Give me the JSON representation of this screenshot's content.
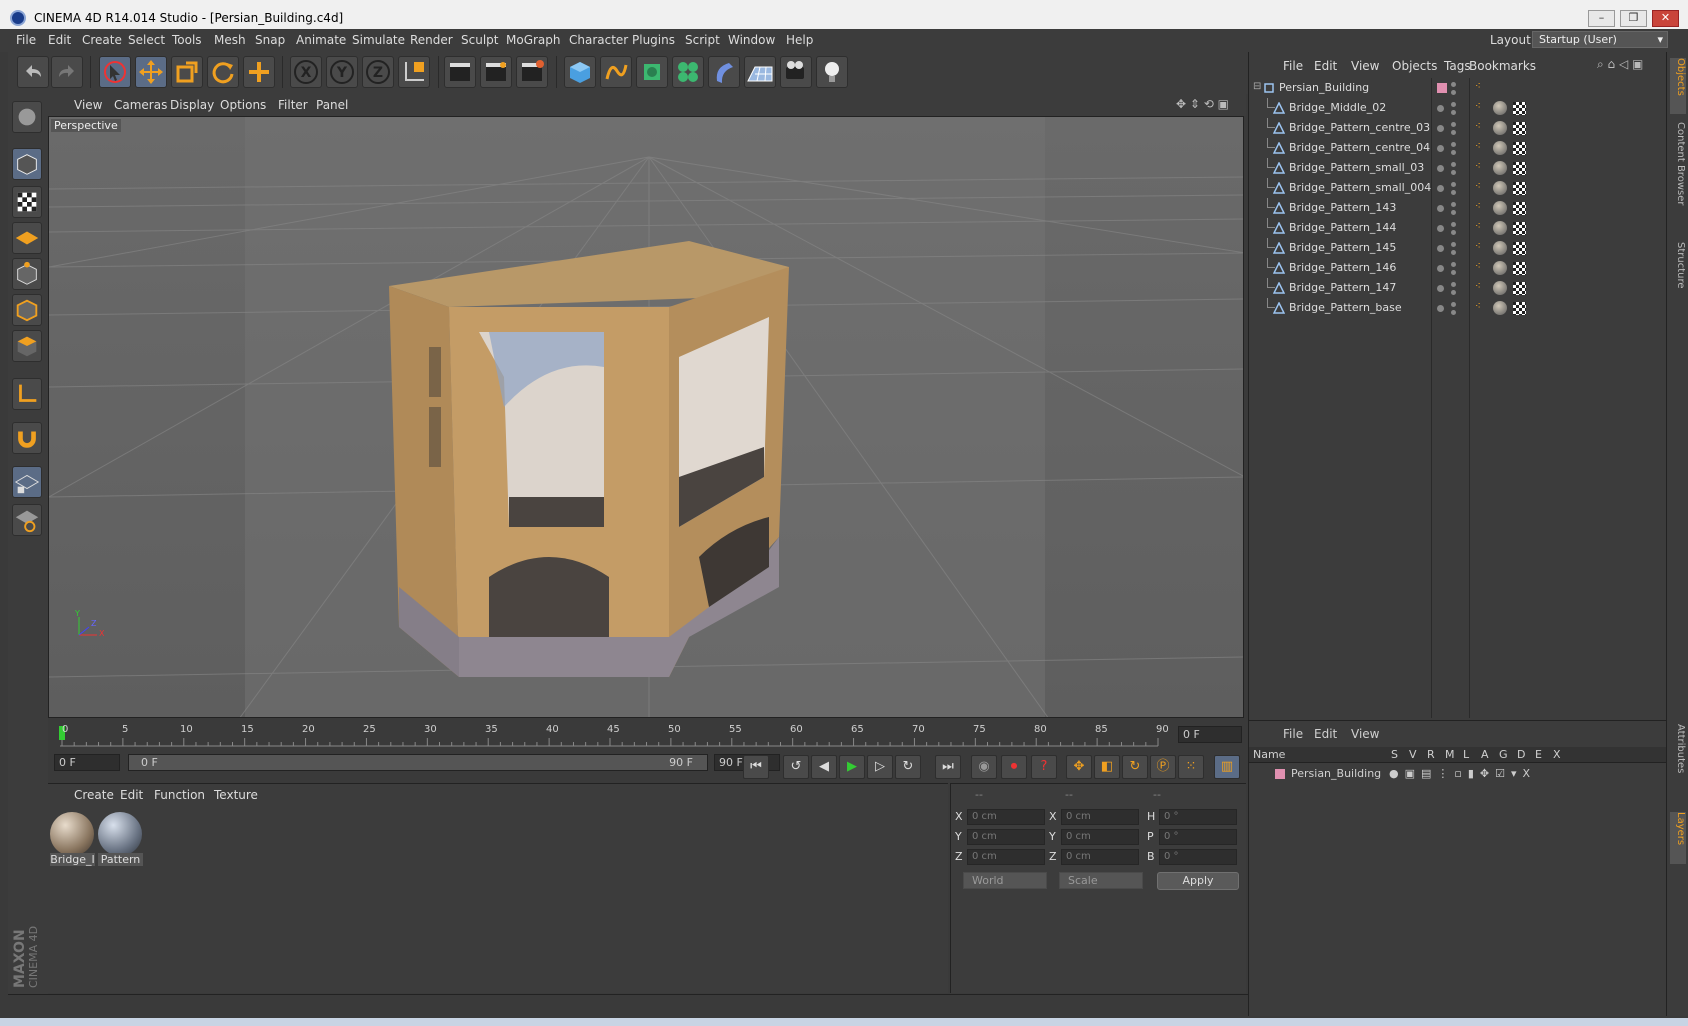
{
  "window": {
    "title": "CINEMA 4D R14.014 Studio - [Persian_Building.c4d]"
  },
  "menubar": {
    "items": [
      "File",
      "Edit",
      "Create",
      "Select",
      "Tools",
      "Mesh",
      "Snap",
      "Animate",
      "Simulate",
      "Render",
      "Sculpt",
      "MoGraph",
      "Character",
      "Plugins",
      "Script",
      "Window",
      "Help"
    ]
  },
  "layout": {
    "label": "Layout:",
    "value": "Startup (User)"
  },
  "viewport": {
    "menu": [
      "View",
      "Cameras",
      "Display",
      "Options",
      "Filter",
      "Panel"
    ],
    "label": "Perspective",
    "axis": {
      "y": "Y",
      "x": "X",
      "z": "Z"
    }
  },
  "timeline": {
    "ticks": [
      "0",
      "5",
      "10",
      "15",
      "20",
      "25",
      "30",
      "35",
      "40",
      "45",
      "50",
      "55",
      "60",
      "65",
      "70",
      "75",
      "80",
      "85",
      "90"
    ],
    "frame_end_field": "0 F"
  },
  "transport": {
    "current_frame": "0 F",
    "range_start": "0 F",
    "range_end": "90 F",
    "end_frame": "90 F"
  },
  "materials": {
    "menu": [
      "Create",
      "Edit",
      "Function",
      "Texture"
    ],
    "items": [
      {
        "name": "Bridge_I"
      },
      {
        "name": "Pattern"
      }
    ]
  },
  "coords": {
    "headers": [
      "--",
      "--",
      "--"
    ],
    "rows": [
      {
        "a": "X",
        "av": "0 cm",
        "b": "X",
        "bv": "0 cm",
        "c": "H",
        "cv": "0 °"
      },
      {
        "a": "Y",
        "av": "0 cm",
        "b": "Y",
        "bv": "0 cm",
        "c": "P",
        "cv": "0 °"
      },
      {
        "a": "Z",
        "av": "0 cm",
        "b": "Z",
        "bv": "0 cm",
        "c": "B",
        "cv": "0 °"
      }
    ],
    "space": "World",
    "mode": "Scale",
    "apply": "Apply"
  },
  "objects": {
    "menu": [
      "File",
      "Edit",
      "View",
      "Objects",
      "Tags",
      "Bookmarks"
    ],
    "root": "Persian_Building",
    "children": [
      "Bridge_Middle_02",
      "Bridge_Pattern_centre_03",
      "Bridge_Pattern_centre_04",
      "Bridge_Pattern_small_03",
      "Bridge_Pattern_small_004",
      "Bridge_Pattern_143",
      "Bridge_Pattern_144",
      "Bridge_Pattern_145",
      "Bridge_Pattern_146",
      "Bridge_Pattern_147",
      "Bridge_Pattern_base"
    ]
  },
  "layers": {
    "menu": [
      "File",
      "Edit",
      "View"
    ],
    "columns": [
      "Name",
      "S",
      "V",
      "R",
      "M",
      "L",
      "A",
      "G",
      "D",
      "E",
      "X"
    ],
    "rows": [
      {
        "name": "Persian_Building"
      }
    ]
  },
  "side_tabs": [
    "Objects",
    "Content Browser",
    "Structure",
    "Attributes",
    "Layers"
  ],
  "brand": {
    "line1": "MAXON",
    "line2": "CINEMA 4D"
  },
  "colors": {
    "accent": "#f0a020",
    "panel": "#3c3c3c",
    "viewport": "#6c6c6c",
    "layer_color": "#e090b0"
  }
}
